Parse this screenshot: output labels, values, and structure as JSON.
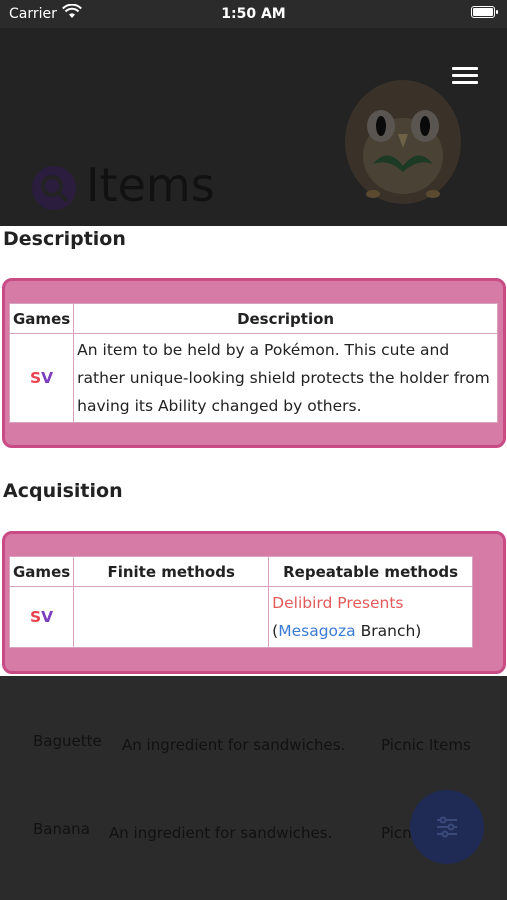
{
  "status_bar": {
    "carrier": "Carrier",
    "time": "1:50 AM"
  },
  "header": {
    "title": "Items"
  },
  "description_section": {
    "heading": "Description",
    "table": {
      "columns": [
        "Games",
        "Description"
      ],
      "rows": [
        {
          "game_s": "S",
          "game_v": "V",
          "text": "An item to be held by a Pokémon. This cute and rather unique-looking shield protects the holder from having its Ability changed by others."
        }
      ]
    }
  },
  "acquisition_section": {
    "heading": "Acquisition",
    "table": {
      "columns": [
        "Games",
        "Finite methods",
        "Repeatable methods"
      ],
      "rows": [
        {
          "game_s": "S",
          "game_v": "V",
          "finite": "",
          "repeatable_link": "Delibird Presents",
          "location_open": "(",
          "location_link": "Mesagoza",
          "location_suffix": " Branch)"
        }
      ]
    }
  },
  "background_list": [
    {
      "name": "Baguette",
      "description": "An ingredient for sandwiches.",
      "category": "Picnic Items"
    },
    {
      "name": "Banana",
      "description": "An ingredient for sandwiches.",
      "category": "Picni"
    }
  ],
  "colors": {
    "accent": "#c94b86",
    "box_fill": "#d67ba6",
    "fab": "#1f2a55"
  },
  "icons": {
    "menu": "hamburger-icon",
    "filter": "filter-sliders-icon",
    "logo": "search-magnifier-icon",
    "wifi": "wifi-icon",
    "battery": "battery-icon"
  }
}
